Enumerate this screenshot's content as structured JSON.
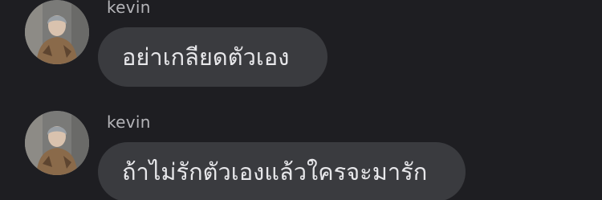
{
  "messages": [
    {
      "sender": "kevin",
      "text": "อย่าเกลียดตัวเอง"
    },
    {
      "sender": "kevin",
      "text": "ถ้าไม่รักตัวเองแล้วใครจะมารัก"
    }
  ],
  "colors": {
    "background": "#1e1e22",
    "bubble": "#3a3b3f",
    "bubble_text": "#e7e7ea",
    "sender_text": "#b4b4b8"
  }
}
